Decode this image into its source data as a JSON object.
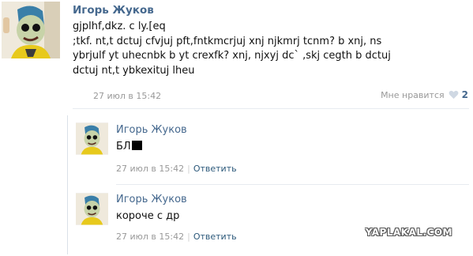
{
  "post": {
    "author": "Игорь Жуков",
    "text_lines": [
      "gjplhf,dkz. c ly.[eq",
      ";tkf. nt,t dctuj cfvjuj pft,fntkmcrjuj xnj njkmrj tcnm? b xnj, ns",
      "ybrjulf yt uhecnbk b yt crexfk? xnj, njxyj dc` ,skj cegth b dctuj",
      "dctuj nt,t ybkexituj lheu"
    ],
    "time": "27 июл в 15:42",
    "like_label": "Мне нравится",
    "like_count": "2",
    "like_icon": "heart-icon"
  },
  "comments": [
    {
      "author": "Игорь Жуков",
      "text": "БЛ",
      "has_censor_block": true,
      "time": "27 июл в 15:42",
      "reply_label": "Ответить"
    },
    {
      "author": "Игорь Жуков",
      "text": "короче с др",
      "time": "27 июл в 15:42",
      "reply_label": "Ответить"
    }
  ],
  "watermark": "YAPLAKAL.COM",
  "colors": {
    "link": "#45688e",
    "meta": "#999999",
    "reply": "#2b587a",
    "heart": "#cfd8e3"
  }
}
